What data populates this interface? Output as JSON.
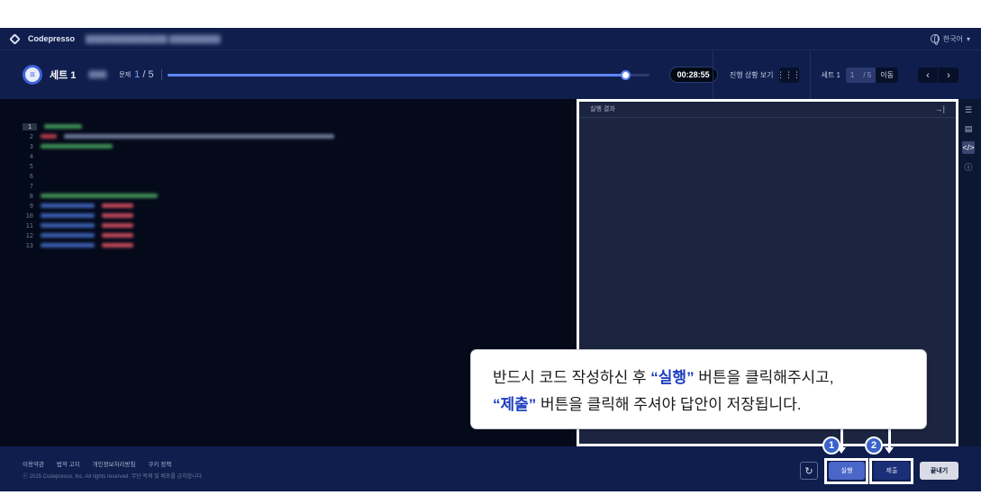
{
  "topbar": {
    "app_name": "Codepresso",
    "breadcrumb": "████████████████ ██████████",
    "language": "한국어"
  },
  "header": {
    "set_title": "세트 1",
    "set_sub": "████",
    "question_label": "문제",
    "question_current": "1",
    "question_total": "/ 5",
    "progress": 0.95,
    "timer": "00:28:55",
    "status_view_label": "진행 상황 보기",
    "set_label": "세트 1",
    "pager_current": "1",
    "pager_total": "/ 5",
    "go_label": "이동"
  },
  "editor": {
    "line_numbers": [
      "1",
      "2",
      "3",
      "4",
      "5",
      "6",
      "7",
      "8",
      "9",
      "10",
      "11",
      "12",
      "13"
    ]
  },
  "result_panel": {
    "title": "실행 결과"
  },
  "footer": {
    "links": [
      "이용약관",
      "법적 고지",
      "개인정보처리방침",
      "쿠키 정책"
    ],
    "copyright": "ⓒ 2025 Codepresso, Inc. All rights reserved. 무단 복제 및 배포를 금지합니다.",
    "run_label": "실행",
    "submit_label": "제출",
    "end_label": "끝내기"
  },
  "callout": {
    "line1_pre": "반드시 코드 작성하신 후 ",
    "line1_quote": "“실행”",
    "line1_post": " 버튼을 클릭해주시고,",
    "line2_quote": "“제출”",
    "line2_post": " 버튼을 클릭해 주셔야 답안이 저장됩니다.",
    "badge1": "1",
    "badge2": "2"
  },
  "colors": {
    "background": "#0b1733",
    "accent": "#5f86f5",
    "highlight": "#ffffff",
    "callout_quote": "#1b3cbf"
  }
}
